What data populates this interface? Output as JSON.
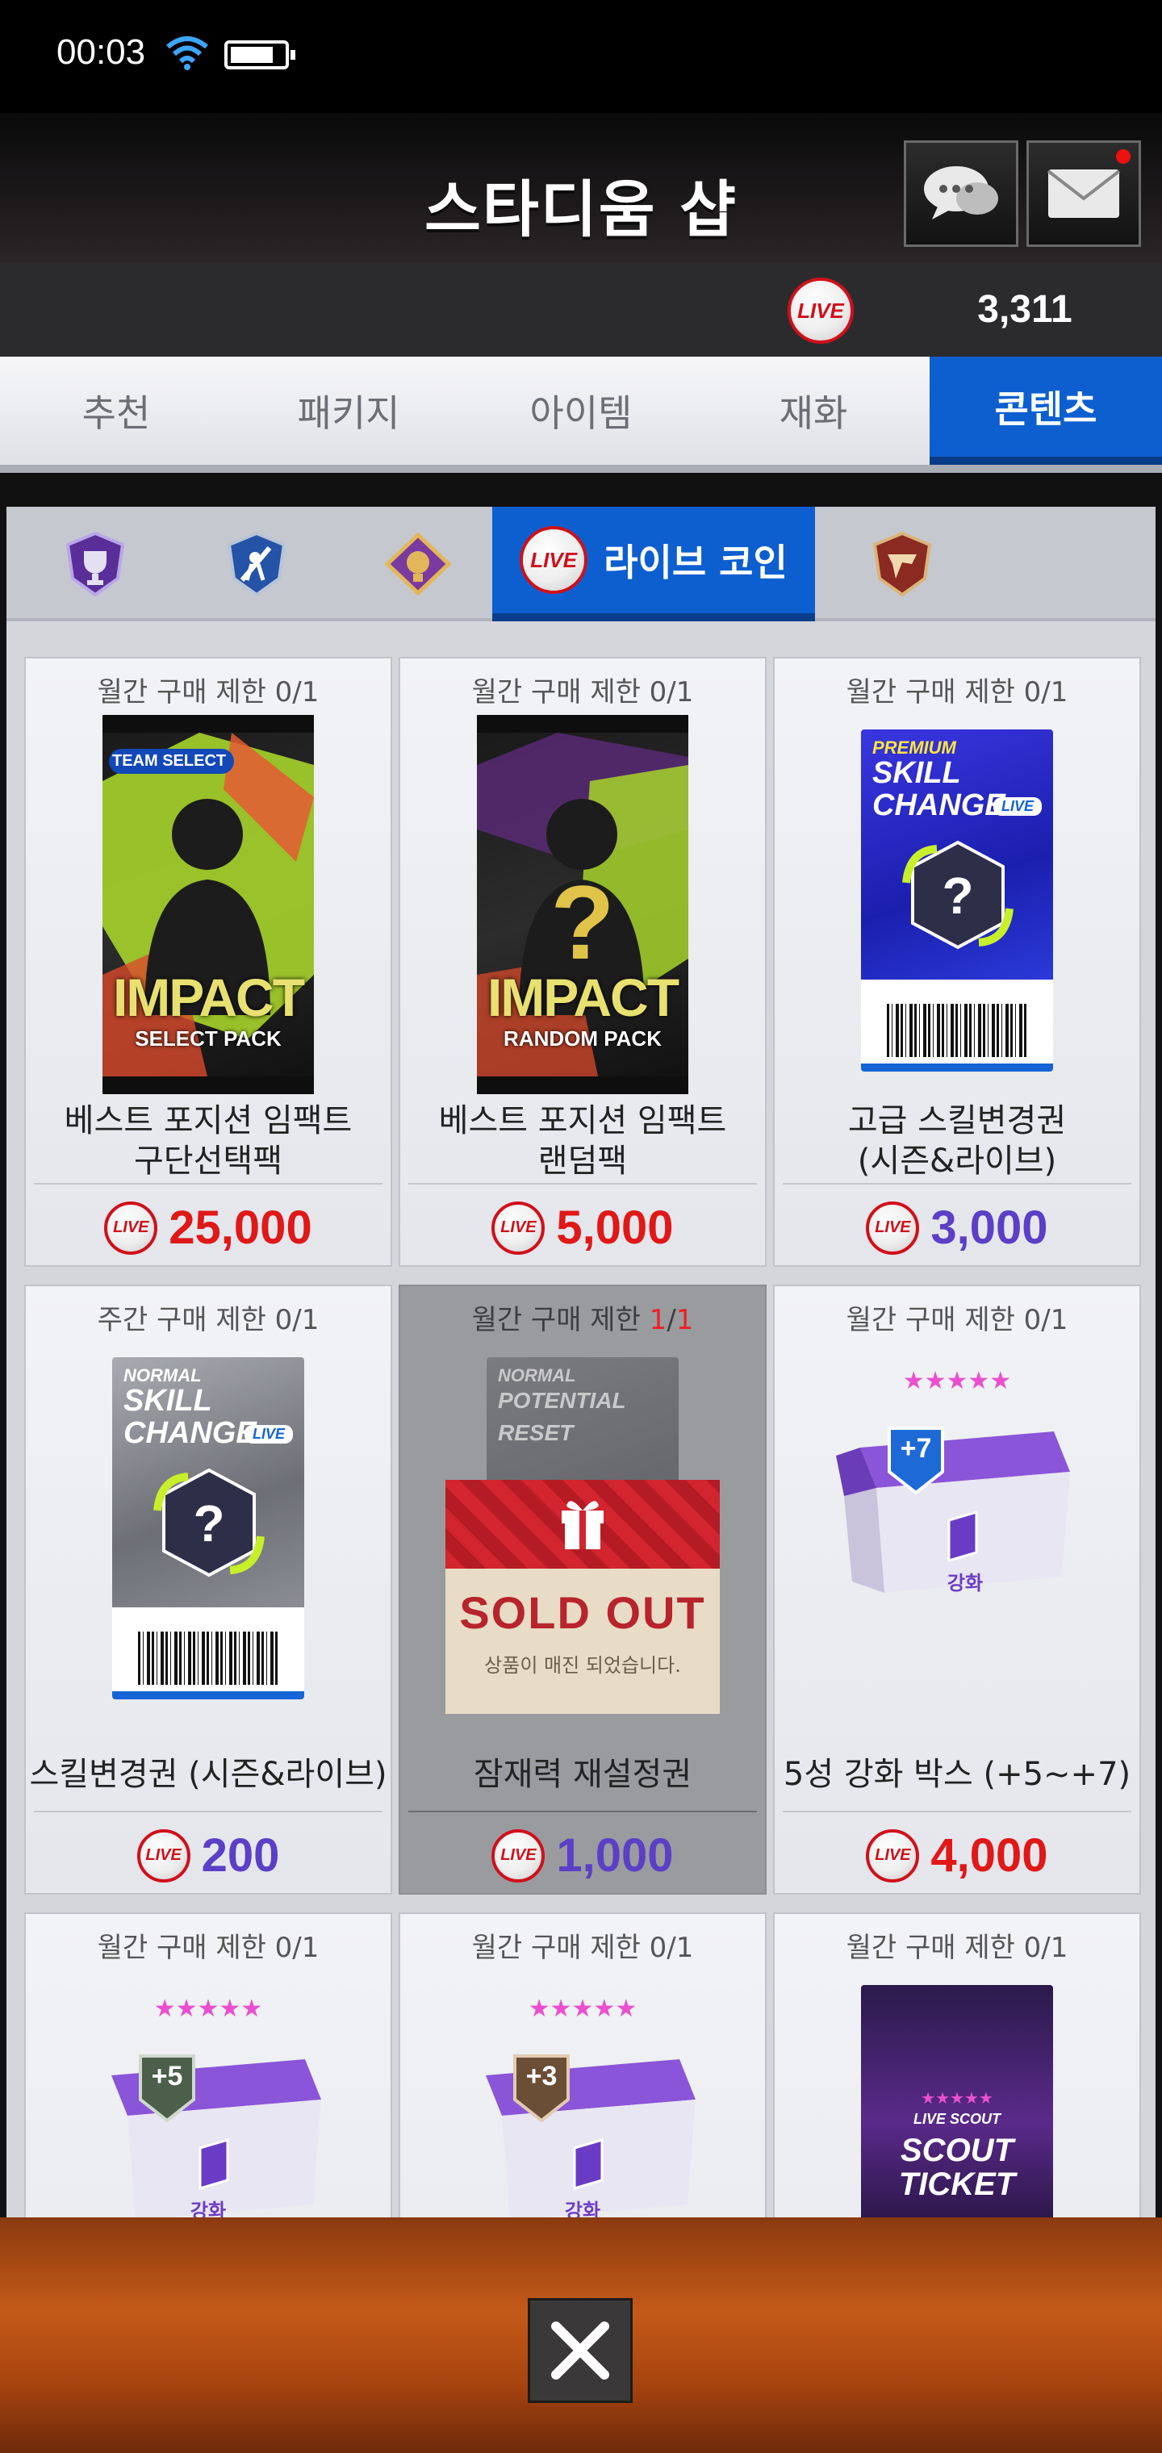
{
  "status": {
    "time": "00:03"
  },
  "header": {
    "title": "스타디움 샵"
  },
  "currency": {
    "coin_label": "LIVE",
    "amount": "3,311"
  },
  "main_tabs": [
    {
      "label": "추천"
    },
    {
      "label": "패키지"
    },
    {
      "label": "아이템"
    },
    {
      "label": "재화"
    },
    {
      "label": "콘텐츠",
      "active": true
    }
  ],
  "sub_tabs": {
    "active_label": "라이브 코인",
    "coin_label": "LIVE"
  },
  "cards": [
    {
      "limit": "월간 구매 제한 0/1",
      "name_line1": "베스트 포지션 임팩트",
      "name_line2": "구단선택팩",
      "price": "25,000",
      "art": {
        "tag": "TEAM SELECT",
        "big": "IMPACT",
        "sub": "SELECT PACK"
      }
    },
    {
      "limit": "월간 구매 제한 0/1",
      "name_line1": "베스트 포지션 임팩트",
      "name_line2": "랜덤팩",
      "price": "5,000",
      "art": {
        "mark": "?",
        "big": "IMPACT",
        "sub": "RANDOM PACK"
      }
    },
    {
      "limit": "월간 구매 제한 0/1",
      "name_line1": "고급 스킬변경권",
      "name_line2": "(시즌&라이브)",
      "price": "3,000",
      "art": {
        "tier": "PREMIUM",
        "title1": "SKILL",
        "title2": "CHANGE",
        "live": "LIVE",
        "mark": "?"
      }
    },
    {
      "limit": "주간 구매 제한 0/1",
      "name": "스킬변경권 (시즌&라이브)",
      "price": "200",
      "art": {
        "tier": "NORMAL",
        "title1": "SKILL",
        "title2": "CHANGE",
        "live": "LIVE",
        "mark": "?"
      }
    },
    {
      "limit_prefix": "월간 구매 제한 ",
      "limit_count": "1",
      "limit_sep": "/",
      "limit_total": "1",
      "name": "잠재력 재설정권",
      "price": "1,000",
      "art": {
        "tier": "NORMAL",
        "title": "POTENTIAL RESET",
        "sold_out": "SOLD OUT",
        "sold_out_sub": "상품이 매진 되었습니다."
      }
    },
    {
      "limit": "월간 구매 제한 0/1",
      "name": "5성 강화 박스 (+5~+7)",
      "price": "4,000",
      "art": {
        "badge": "+7",
        "label": "강화",
        "stars": "★★★★★"
      }
    },
    {
      "limit": "월간 구매 제한 0/1",
      "art": {
        "badge": "+5",
        "stars": "★★★★★",
        "label": "강화"
      }
    },
    {
      "limit": "월간 구매 제한 0/1",
      "art": {
        "badge": "+3",
        "stars": "★★★★★",
        "label": "강화"
      }
    },
    {
      "limit": "월간 구매 제한 0/1",
      "art": {
        "stars": "★★★★★",
        "tag": "LIVE SCOUT",
        "title1": "SCOUT",
        "title2": "TICKET"
      }
    }
  ],
  "colors": {
    "active_tab": "#0d5fcf",
    "price_red": "#e01818",
    "price_purple": "#5b3fc6",
    "live_red": "#d0101a"
  }
}
